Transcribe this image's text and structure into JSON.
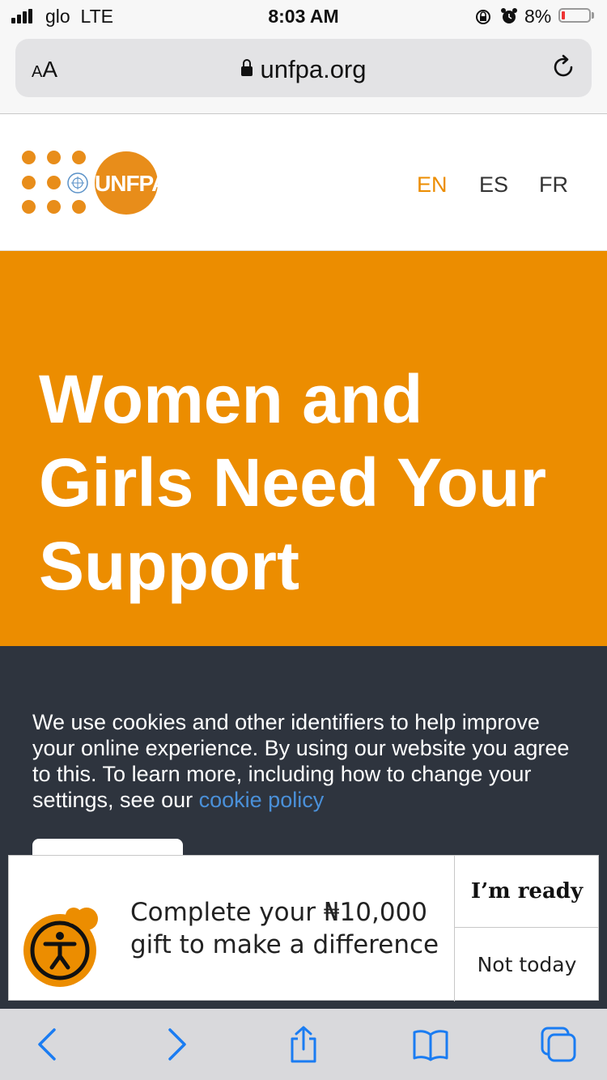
{
  "status_bar": {
    "carrier": "glo",
    "network": "LTE",
    "time": "8:03 AM",
    "battery": "8%"
  },
  "browser": {
    "text_size_label_small": "A",
    "text_size_label_large": "A",
    "url": "unfpa.org"
  },
  "site": {
    "logo_text": "UNFPA",
    "languages": [
      {
        "code": "EN",
        "active": true
      },
      {
        "code": "ES",
        "active": false
      },
      {
        "code": "FR",
        "active": false
      }
    ]
  },
  "hero": {
    "title": "Women and Girls Need Your Support"
  },
  "cookie_banner": {
    "text": "We use cookies and other identifiers to help improve your online experience. By using our website you agree to this. To learn more, including how to change your settings, see our ",
    "link_text": "cookie policy"
  },
  "donation_popup": {
    "message_line1": "Complete your ₦10,000",
    "message_line2": "gift to make a difference",
    "primary_label": "I’m ready",
    "secondary_label": "Not today"
  },
  "toolbar": {
    "icons": [
      "back-icon",
      "forward-icon",
      "share-icon",
      "bookmarks-icon",
      "tabs-icon"
    ]
  },
  "colors": {
    "accent": "#ec8d00",
    "link": "#4a90d9",
    "banner_bg": "#2e343e",
    "ios_blue": "#1a7cf2"
  }
}
